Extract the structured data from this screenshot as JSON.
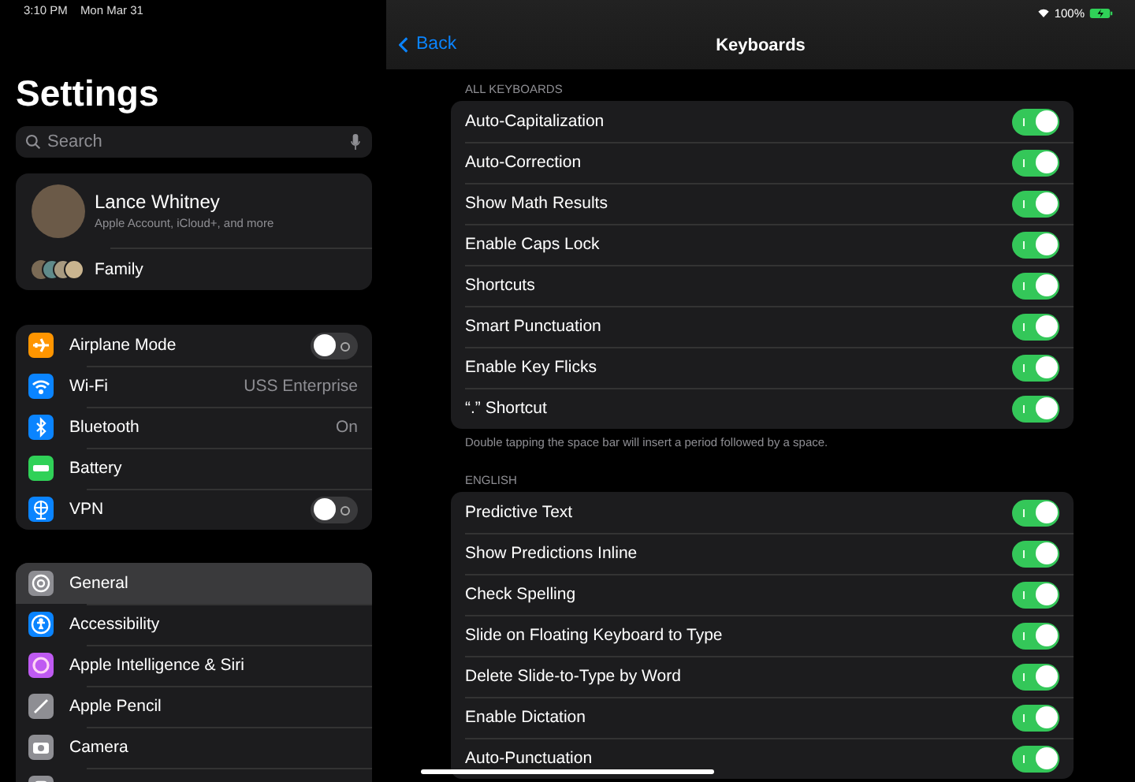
{
  "status_bar": {
    "time": "3:10 PM",
    "date": "Mon Mar 31",
    "battery": "100%"
  },
  "sidebar": {
    "title": "Settings",
    "search": {
      "placeholder": "Search"
    },
    "profile": {
      "name": "Lance Whitney",
      "subtitle": "Apple Account, iCloud+, and more"
    },
    "family": {
      "label": "Family"
    },
    "groups": [
      [
        {
          "label": "Airplane Mode",
          "kind": "toggle",
          "on": false,
          "color": "#ff9500",
          "selected": false
        },
        {
          "label": "Wi-Fi",
          "kind": "value",
          "value": "USS Enterprise",
          "color": "#0a84ff",
          "selected": false
        },
        {
          "label": "Bluetooth",
          "kind": "value",
          "value": "On",
          "color": "#0a84ff",
          "selected": false
        },
        {
          "label": "Battery",
          "kind": "link",
          "color": "#30d158",
          "selected": false
        },
        {
          "label": "VPN",
          "kind": "toggle",
          "on": false,
          "color": "#0a84ff",
          "selected": false
        }
      ],
      [
        {
          "label": "General",
          "kind": "link",
          "color": "#8e8e93",
          "selected": true
        },
        {
          "label": "Accessibility",
          "kind": "link",
          "color": "#0a84ff",
          "selected": false
        },
        {
          "label": "Apple Intelligence & Siri",
          "kind": "link",
          "color": "#bf5af2",
          "selected": false
        },
        {
          "label": "Apple Pencil",
          "kind": "link",
          "color": "#8e8e93",
          "selected": false
        },
        {
          "label": "Camera",
          "kind": "link",
          "color": "#8e8e93",
          "selected": false
        },
        {
          "kind": "link",
          "color": "#8e8e93",
          "selected": false
        }
      ]
    ]
  },
  "nav": {
    "back": "Back",
    "title": "Keyboards"
  },
  "sections": [
    {
      "header": "ALL KEYBOARDS",
      "footer": "Double tapping the space bar will insert a period followed by a space.",
      "rows": [
        {
          "label": "Auto-Capitalization",
          "on": true
        },
        {
          "label": "Auto-Correction",
          "on": true
        },
        {
          "label": "Show Math Results",
          "on": true
        },
        {
          "label": "Enable Caps Lock",
          "on": true
        },
        {
          "label": "Shortcuts",
          "on": true
        },
        {
          "label": "Smart Punctuation",
          "on": true
        },
        {
          "label": "Enable Key Flicks",
          "on": true
        },
        {
          "label": "“.” Shortcut",
          "on": true
        }
      ]
    },
    {
      "header": "ENGLISH",
      "rows": [
        {
          "label": "Predictive Text",
          "on": true
        },
        {
          "label": "Show Predictions Inline",
          "on": true
        },
        {
          "label": "Check Spelling",
          "on": true
        },
        {
          "label": "Slide on Floating Keyboard to Type",
          "on": true
        },
        {
          "label": "Delete Slide-to-Type by Word",
          "on": true
        },
        {
          "label": "Enable Dictation",
          "on": true
        },
        {
          "label": "Auto-Punctuation",
          "on": true
        }
      ]
    }
  ]
}
